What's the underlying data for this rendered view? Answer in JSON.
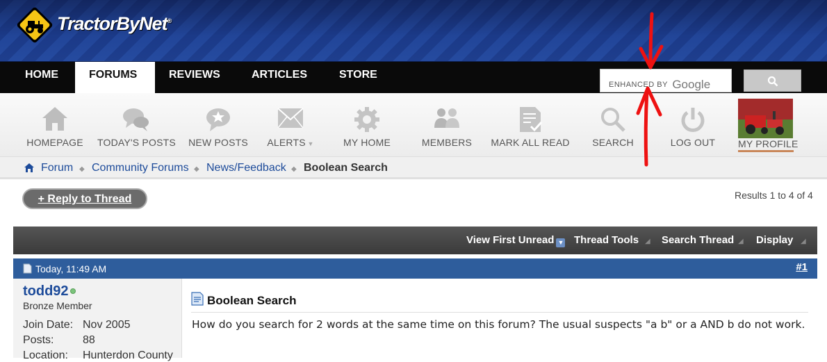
{
  "brand": {
    "name": "TractorByNet",
    "trademark": "®"
  },
  "nav": {
    "tabs": [
      {
        "label": "HOME"
      },
      {
        "label": "FORUMS"
      },
      {
        "label": "REVIEWS"
      },
      {
        "label": "ARTICLES"
      },
      {
        "label": "STORE"
      }
    ],
    "active_tab": "FORUMS"
  },
  "search": {
    "placeholder_prefix": "ENHANCED BY",
    "placeholder_brand": "Google",
    "button_icon": "search-icon"
  },
  "toolbar": {
    "items": [
      {
        "label": "HOMEPAGE",
        "icon": "house-icon"
      },
      {
        "label": "TODAY'S POSTS",
        "icon": "chat-bubbles-icon"
      },
      {
        "label": "NEW POSTS",
        "icon": "star-bubble-icon"
      },
      {
        "label": "ALERTS",
        "icon": "envelope-icon"
      },
      {
        "label": "MY HOME",
        "icon": "gear-icon"
      },
      {
        "label": "MEMBERS",
        "icon": "people-icon"
      },
      {
        "label": "MARK ALL READ",
        "icon": "document-check-icon"
      },
      {
        "label": "SEARCH",
        "icon": "magnifier-icon"
      },
      {
        "label": "LOG OUT",
        "icon": "power-icon"
      },
      {
        "label": "MY PROFILE",
        "icon": "profile-photo"
      }
    ]
  },
  "breadcrumb": {
    "items": [
      "Forum",
      "Community Forums",
      "News/Feedback"
    ],
    "current": "Boolean Search"
  },
  "thread": {
    "reply_label": "+ Reply to Thread",
    "results": "Results 1 to 4 of 4",
    "tools": [
      "View First Unread",
      "Thread Tools",
      "Search Thread",
      "Display"
    ]
  },
  "post": {
    "date": "Today, 11:49 AM",
    "number": "#1",
    "user": {
      "name": "todd92",
      "title": "Bronze Member",
      "fields": [
        {
          "label": "Join Date:",
          "value": "Nov 2005"
        },
        {
          "label": "Posts:",
          "value": "88"
        },
        {
          "label": "Location:",
          "value": "Hunterdon County"
        }
      ]
    },
    "title": "Boolean Search",
    "text": "How do you search for 2 words at the same time on this forum? The usual suspects \"a b\" or a AND b do not work."
  },
  "colors": {
    "header_blue": "#1d3c8a",
    "nav_black": "#0a0a0a",
    "link_blue": "#1d4b9a",
    "post_header_blue": "#2e5d9c",
    "annotation_red": "#ee1111"
  }
}
